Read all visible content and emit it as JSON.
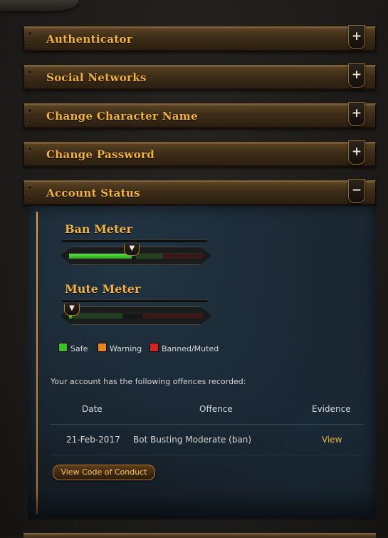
{
  "panels": [
    {
      "title": "Authenticator",
      "toggle": "+"
    },
    {
      "title": "Social Networks",
      "toggle": "+"
    },
    {
      "title": "Change Character Name",
      "toggle": "+"
    },
    {
      "title": "Change Password",
      "toggle": "+"
    },
    {
      "title": "Account Status",
      "toggle": "−"
    }
  ],
  "account_status": {
    "ban_meter": {
      "label": "Ban Meter",
      "level": 0.47
    },
    "mute_meter": {
      "label": "Mute Meter",
      "level": 0.0
    },
    "legend": [
      {
        "label": "Safe",
        "color": "#39c22b"
      },
      {
        "label": "Warning",
        "color": "#e58a1e"
      },
      {
        "label": "Banned/Muted",
        "color": "#d62323"
      }
    ],
    "offences_intro": "Your account has the following offences recorded:",
    "table": {
      "headers": {
        "date": "Date",
        "offence": "Offence",
        "evidence": "Evidence"
      },
      "rows": [
        {
          "date": "21-Feb-2017",
          "offence": "Bot Busting Moderate (ban)",
          "evidence": "View"
        }
      ]
    },
    "conduct_button": "View Code of Conduct"
  },
  "colors": {
    "accent_gold": "#f1b245",
    "link": "#ecb13e",
    "content_bg": "#17232d"
  }
}
